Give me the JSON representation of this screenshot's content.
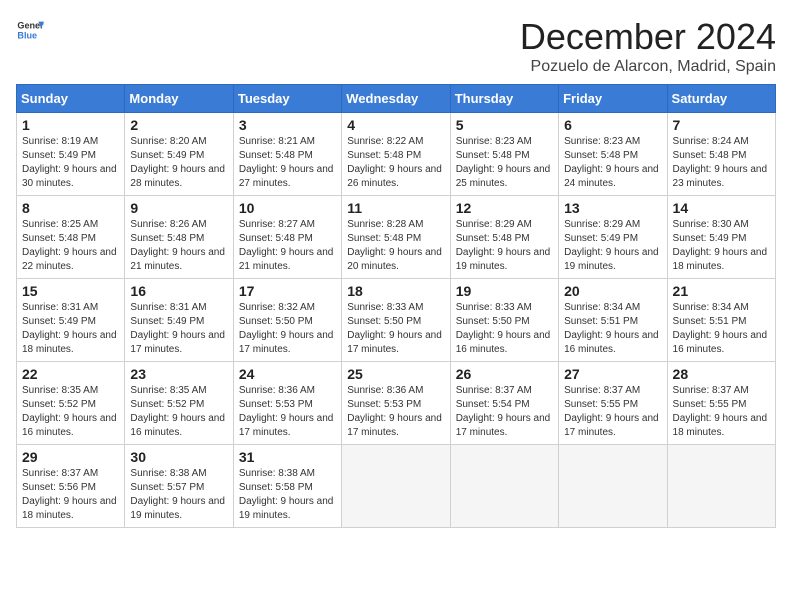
{
  "logo": {
    "line1": "General",
    "line2": "Blue"
  },
  "title": "December 2024",
  "location": "Pozuelo de Alarcon, Madrid, Spain",
  "days_of_week": [
    "Sunday",
    "Monday",
    "Tuesday",
    "Wednesday",
    "Thursday",
    "Friday",
    "Saturday"
  ],
  "weeks": [
    [
      {
        "day": "1",
        "sunrise": "8:19 AM",
        "sunset": "5:49 PM",
        "daylight": "9 hours and 30 minutes."
      },
      {
        "day": "2",
        "sunrise": "8:20 AM",
        "sunset": "5:49 PM",
        "daylight": "9 hours and 28 minutes."
      },
      {
        "day": "3",
        "sunrise": "8:21 AM",
        "sunset": "5:48 PM",
        "daylight": "9 hours and 27 minutes."
      },
      {
        "day": "4",
        "sunrise": "8:22 AM",
        "sunset": "5:48 PM",
        "daylight": "9 hours and 26 minutes."
      },
      {
        "day": "5",
        "sunrise": "8:23 AM",
        "sunset": "5:48 PM",
        "daylight": "9 hours and 25 minutes."
      },
      {
        "day": "6",
        "sunrise": "8:23 AM",
        "sunset": "5:48 PM",
        "daylight": "9 hours and 24 minutes."
      },
      {
        "day": "7",
        "sunrise": "8:24 AM",
        "sunset": "5:48 PM",
        "daylight": "9 hours and 23 minutes."
      }
    ],
    [
      {
        "day": "8",
        "sunrise": "8:25 AM",
        "sunset": "5:48 PM",
        "daylight": "9 hours and 22 minutes."
      },
      {
        "day": "9",
        "sunrise": "8:26 AM",
        "sunset": "5:48 PM",
        "daylight": "9 hours and 21 minutes."
      },
      {
        "day": "10",
        "sunrise": "8:27 AM",
        "sunset": "5:48 PM",
        "daylight": "9 hours and 21 minutes."
      },
      {
        "day": "11",
        "sunrise": "8:28 AM",
        "sunset": "5:48 PM",
        "daylight": "9 hours and 20 minutes."
      },
      {
        "day": "12",
        "sunrise": "8:29 AM",
        "sunset": "5:48 PM",
        "daylight": "9 hours and 19 minutes."
      },
      {
        "day": "13",
        "sunrise": "8:29 AM",
        "sunset": "5:49 PM",
        "daylight": "9 hours and 19 minutes."
      },
      {
        "day": "14",
        "sunrise": "8:30 AM",
        "sunset": "5:49 PM",
        "daylight": "9 hours and 18 minutes."
      }
    ],
    [
      {
        "day": "15",
        "sunrise": "8:31 AM",
        "sunset": "5:49 PM",
        "daylight": "9 hours and 18 minutes."
      },
      {
        "day": "16",
        "sunrise": "8:31 AM",
        "sunset": "5:49 PM",
        "daylight": "9 hours and 17 minutes."
      },
      {
        "day": "17",
        "sunrise": "8:32 AM",
        "sunset": "5:50 PM",
        "daylight": "9 hours and 17 minutes."
      },
      {
        "day": "18",
        "sunrise": "8:33 AM",
        "sunset": "5:50 PM",
        "daylight": "9 hours and 17 minutes."
      },
      {
        "day": "19",
        "sunrise": "8:33 AM",
        "sunset": "5:50 PM",
        "daylight": "9 hours and 16 minutes."
      },
      {
        "day": "20",
        "sunrise": "8:34 AM",
        "sunset": "5:51 PM",
        "daylight": "9 hours and 16 minutes."
      },
      {
        "day": "21",
        "sunrise": "8:34 AM",
        "sunset": "5:51 PM",
        "daylight": "9 hours and 16 minutes."
      }
    ],
    [
      {
        "day": "22",
        "sunrise": "8:35 AM",
        "sunset": "5:52 PM",
        "daylight": "9 hours and 16 minutes."
      },
      {
        "day": "23",
        "sunrise": "8:35 AM",
        "sunset": "5:52 PM",
        "daylight": "9 hours and 16 minutes."
      },
      {
        "day": "24",
        "sunrise": "8:36 AM",
        "sunset": "5:53 PM",
        "daylight": "9 hours and 17 minutes."
      },
      {
        "day": "25",
        "sunrise": "8:36 AM",
        "sunset": "5:53 PM",
        "daylight": "9 hours and 17 minutes."
      },
      {
        "day": "26",
        "sunrise": "8:37 AM",
        "sunset": "5:54 PM",
        "daylight": "9 hours and 17 minutes."
      },
      {
        "day": "27",
        "sunrise": "8:37 AM",
        "sunset": "5:55 PM",
        "daylight": "9 hours and 17 minutes."
      },
      {
        "day": "28",
        "sunrise": "8:37 AM",
        "sunset": "5:55 PM",
        "daylight": "9 hours and 18 minutes."
      }
    ],
    [
      {
        "day": "29",
        "sunrise": "8:37 AM",
        "sunset": "5:56 PM",
        "daylight": "9 hours and 18 minutes."
      },
      {
        "day": "30",
        "sunrise": "8:38 AM",
        "sunset": "5:57 PM",
        "daylight": "9 hours and 19 minutes."
      },
      {
        "day": "31",
        "sunrise": "8:38 AM",
        "sunset": "5:58 PM",
        "daylight": "9 hours and 19 minutes."
      },
      null,
      null,
      null,
      null
    ]
  ]
}
